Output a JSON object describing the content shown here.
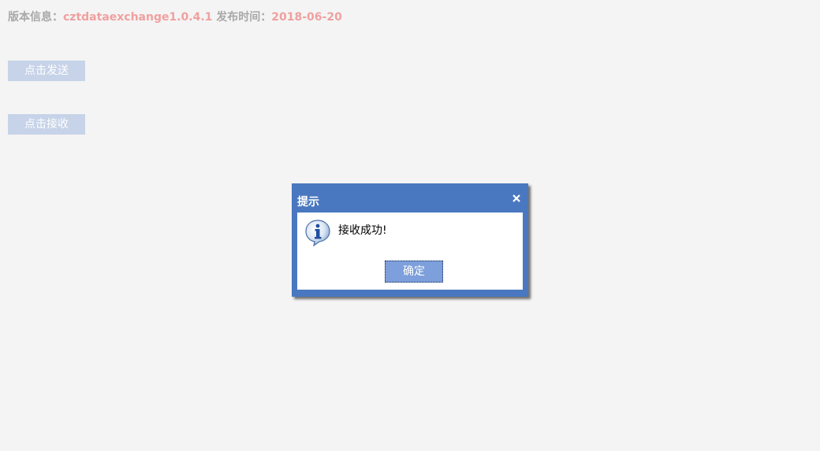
{
  "header": {
    "version_label": "版本信息：",
    "version_value": "cztdataexchange1.0.4.1",
    "release_label": " 发布时间：",
    "release_value": "2018-06-20"
  },
  "actions": {
    "send_label": "点击发送",
    "receive_label": "点击接收"
  },
  "dialog": {
    "title": "提示",
    "message": "接收成功!",
    "ok_label": "确定",
    "close_icon": "close-icon",
    "info_icon": "info-icon"
  },
  "colors": {
    "background": "#f4f4f4",
    "header_label": "#a8a8a8",
    "header_value": "#f0a0a0",
    "action_button": "#c6d3e8",
    "dialog_frame": "#4a78c0",
    "ok_button": "#7d9fdb"
  }
}
